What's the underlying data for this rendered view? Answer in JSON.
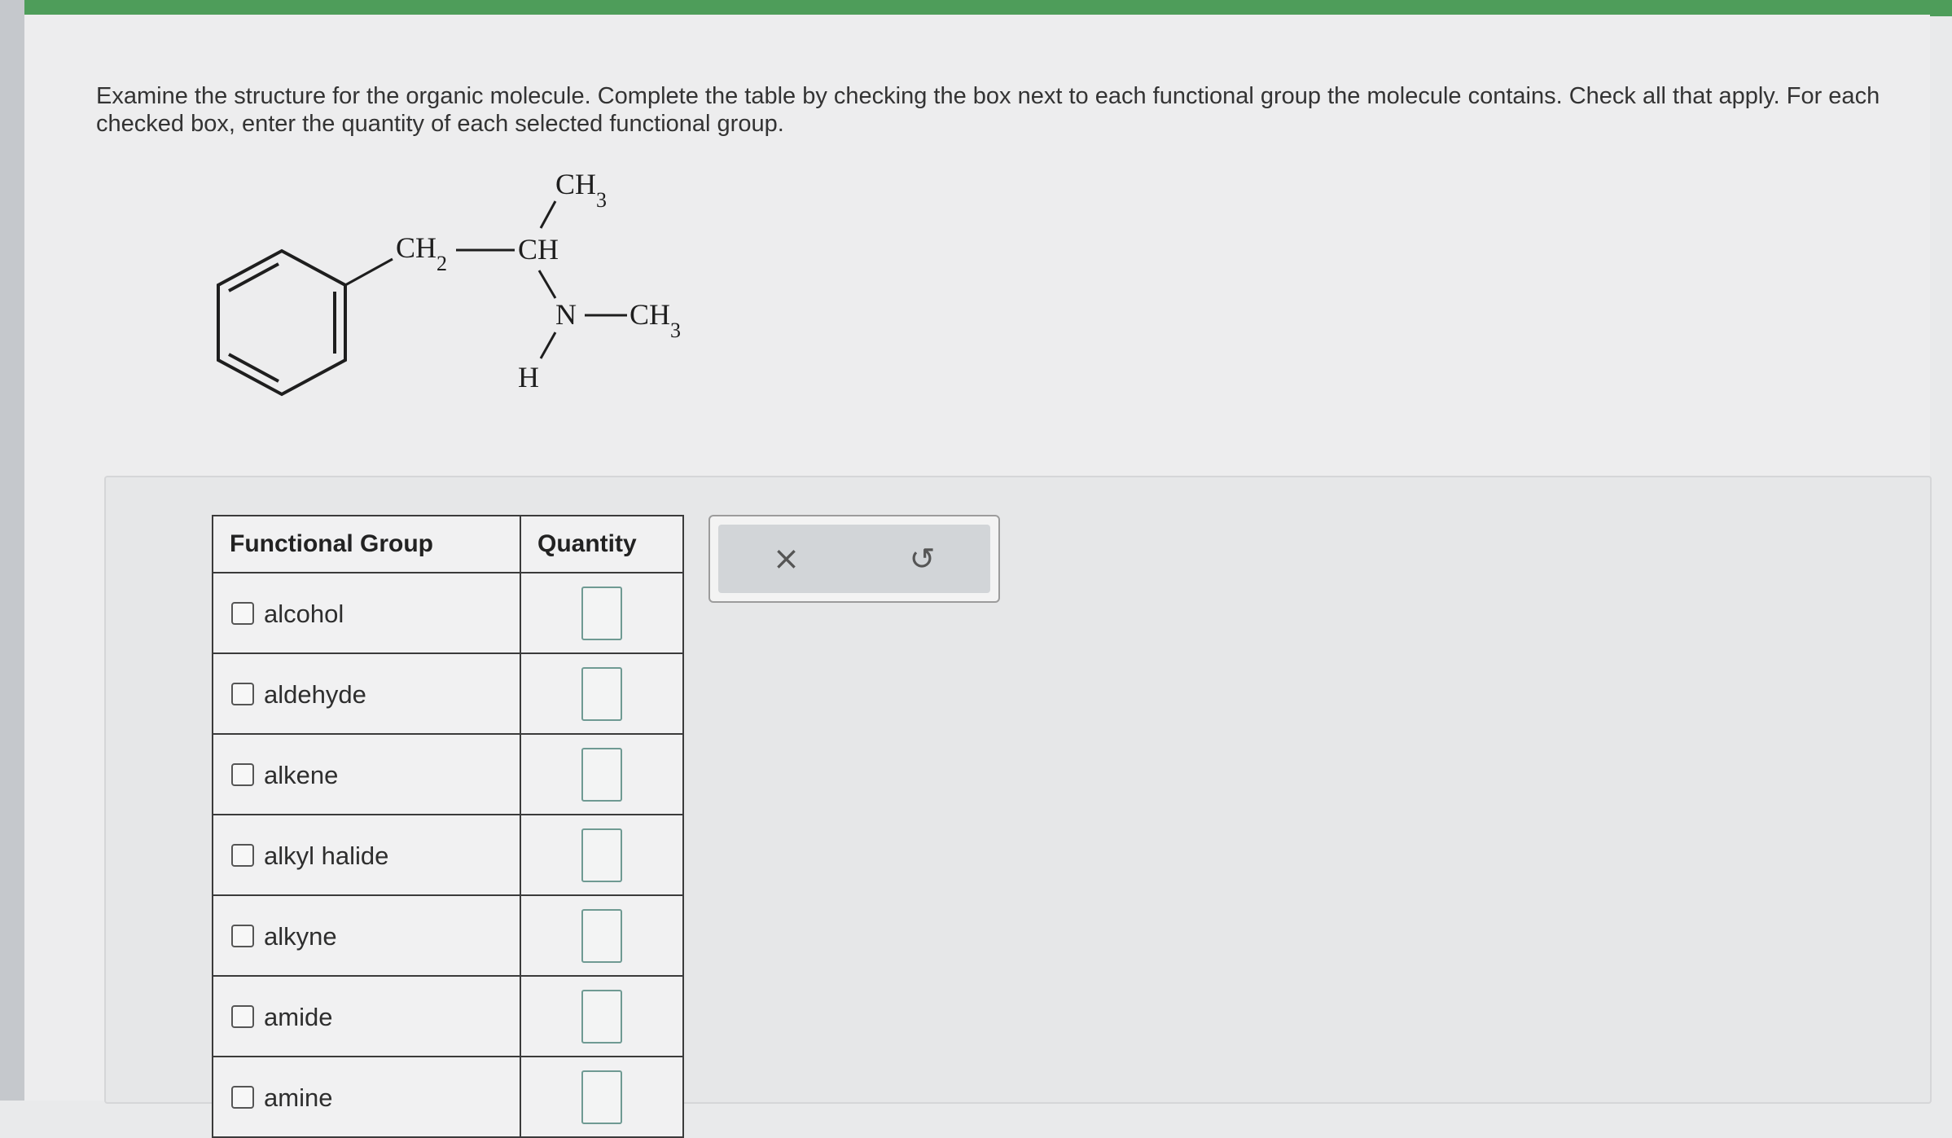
{
  "instructions": "Examine the structure for the organic molecule. Complete the table by checking the box next to each functional group the molecule contains. Check all that apply. For each checked box, enter the quantity of each selected functional group.",
  "molecule": {
    "ch2_label": "CH",
    "ch2_sub": "2",
    "ch_label": "CH",
    "top_ch3_label": "CH",
    "top_ch3_sub": "3",
    "n_label": "N",
    "right_ch3_label": "CH",
    "right_ch3_sub": "3",
    "h_label": "H"
  },
  "table": {
    "header_group": "Functional Group",
    "header_quantity": "Quantity",
    "rows": [
      {
        "name": "alcohol",
        "checked": false,
        "quantity": ""
      },
      {
        "name": "aldehyde",
        "checked": false,
        "quantity": ""
      },
      {
        "name": "alkene",
        "checked": false,
        "quantity": ""
      },
      {
        "name": "alkyl halide",
        "checked": false,
        "quantity": ""
      },
      {
        "name": "alkyne",
        "checked": false,
        "quantity": ""
      },
      {
        "name": "amide",
        "checked": false,
        "quantity": ""
      },
      {
        "name": "amine",
        "checked": false,
        "quantity": ""
      }
    ]
  },
  "actions": {
    "clear_icon": "×",
    "undo_icon": "↺"
  },
  "colors": {
    "accent_bar": "#4e9d5a",
    "input_border": "#6f9a93"
  }
}
